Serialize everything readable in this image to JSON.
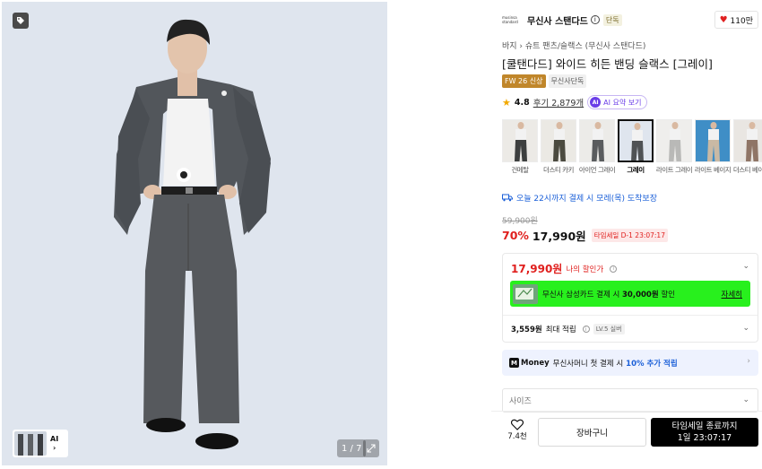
{
  "gallery": {
    "pager": "1 / 7",
    "ai_label": "AI"
  },
  "brand": {
    "logo_line1": "musinsa",
    "logo_line2": "standard",
    "name": "무신사 스탠다드",
    "info": "i",
    "badge": "단독",
    "likes": "110만"
  },
  "product": {
    "breadcrumb": "바지 › 슈트 팬츠/슬랙스 (무신사 스탠다드)",
    "title": "[쿨탠다드] 와이드 히든 밴딩 슬랙스 [그레이]",
    "badges": [
      "FW 26 신상",
      "무신사단독"
    ],
    "rating": "4.8",
    "review_text": "후기 2,879개",
    "ai_summary": "AI 요약 보기",
    "ai_icon": "AI"
  },
  "colors": [
    {
      "label": "건메탈",
      "swatch": "#3d3f3f",
      "bg": "#eceae6",
      "selected": false
    },
    {
      "label": "더스티 카키",
      "swatch": "#4b4a3f",
      "bg": "#ebe9e4",
      "selected": false
    },
    {
      "label": "아이언 그레이",
      "swatch": "#5a5c5e",
      "bg": "#ecebe8",
      "selected": false
    },
    {
      "label": "그레이",
      "swatch": "#4f5255",
      "bg": "#dfe5ee",
      "selected": true
    },
    {
      "label": "라이트 그레이",
      "swatch": "#b9b9b7",
      "bg": "#efeeec",
      "selected": false
    },
    {
      "label": "라이트 베이지",
      "swatch": "#c9b9a4",
      "bg": "#3f8ec6",
      "selected": false
    },
    {
      "label": "더스티 베이지",
      "swatch": "#8f7566",
      "bg": "#e9e6e2",
      "selected": false
    }
  ],
  "delivery": {
    "text": "오늘 22시까지 결제 시 모레(목) 도착보장"
  },
  "price": {
    "original": "59,900원",
    "discount": "70%",
    "sale": "17,990원",
    "timesale": "타임세일 D-1 23:07:17"
  },
  "benefits": {
    "my_price": "17,990원",
    "my_price_label": "나의 할인가",
    "card_prefix": "무신사 삼성카드 결제 시",
    "card_amount": "30,000원",
    "card_suffix": "할인",
    "card_detail": "자세히",
    "points_amount": "3,559원",
    "points_label": "최대 적립",
    "level": "LV.5 실버"
  },
  "money": {
    "logo": "M",
    "word": "Money",
    "text": "무신사머니 첫 결제 시",
    "highlight": "10% 추가 적립"
  },
  "size": {
    "placeholder": "사이즈"
  },
  "footer": {
    "like_count": "7.4천",
    "cart_label": "장바구니",
    "buy_line1": "타임세일 종료까지",
    "buy_line2": "1일 23:07:17"
  },
  "colors_theme": {
    "accent_red": "#e0201e",
    "accent_blue": "#1a5fd8",
    "banner_green": "#28f01d"
  }
}
